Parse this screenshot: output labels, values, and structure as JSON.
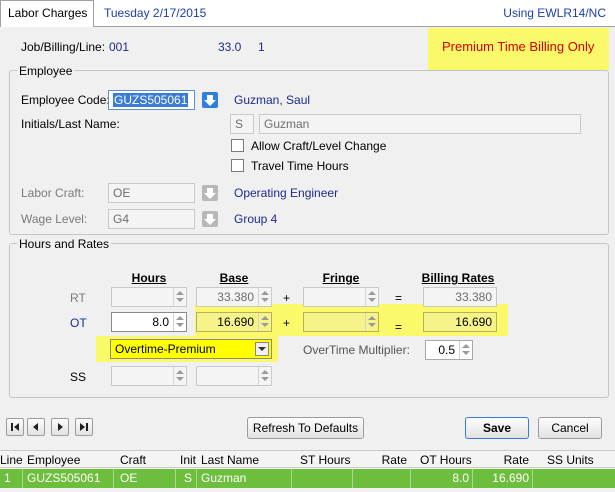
{
  "header": {
    "tab_label": "Labor Charges",
    "date": "Tuesday  2/17/2015",
    "using": "Using EWLR14/NC"
  },
  "job": {
    "label": "Job/Billing/Line:",
    "job_no": "001",
    "billing": "33.0",
    "line": "1",
    "banner": "Premium Time Billing Only"
  },
  "employee": {
    "group_title": "Employee",
    "code_label": "Employee Code:",
    "code_value": "GUZS505061",
    "name": "Guzman, Saul",
    "initials_label": "Initials/Last Name:",
    "initial": "S",
    "last_name": "Guzman",
    "allow_craft_label": "Allow Craft/Level Change",
    "travel_label": "Travel Time Hours",
    "labor_craft_label": "Labor Craft:",
    "labor_craft_code": "OE",
    "labor_craft_name": "Operating Engineer",
    "wage_level_label": "Wage Level:",
    "wage_level_code": "G4",
    "wage_level_name": "Group 4"
  },
  "hours": {
    "group_title": "Hours and Rates",
    "col_hours": "Hours",
    "col_base": "Base",
    "col_fringe": "Fringe",
    "col_billing": "Billing Rates",
    "plus": "+",
    "equals": "=",
    "rt_label": "RT",
    "rt_base": "33.380",
    "rt_billing": "33.380",
    "ot_label": "OT",
    "ot_hours": "8.0",
    "ot_base": "16.690",
    "ot_billing": "16.690",
    "ss_label": "SS",
    "premium_select": "Overtime-Premium",
    "multiplier_label": "OverTime Multiplier:",
    "multiplier_value": "0.5"
  },
  "footer": {
    "refresh_label": "Refresh To Defaults",
    "save_label": "Save",
    "cancel_label": "Cancel"
  },
  "grid": {
    "columns": [
      "Line",
      "Employee",
      "Craft",
      "Init",
      "Last Name",
      "ST Hours",
      "Rate",
      "OT Hours",
      "Rate",
      "SS Units"
    ],
    "rows": [
      [
        "1",
        "GUZS505061",
        "OE",
        "S",
        "Guzman",
        "",
        "",
        "8.0",
        "16.690",
        ""
      ]
    ]
  },
  "colors": {
    "highlight": "#fbf96a",
    "banner_text": "#d40000",
    "link_blue": "#1c2a8c",
    "selected_row": "#6ebe3e",
    "dropdown_button": "#2f7fe0"
  }
}
